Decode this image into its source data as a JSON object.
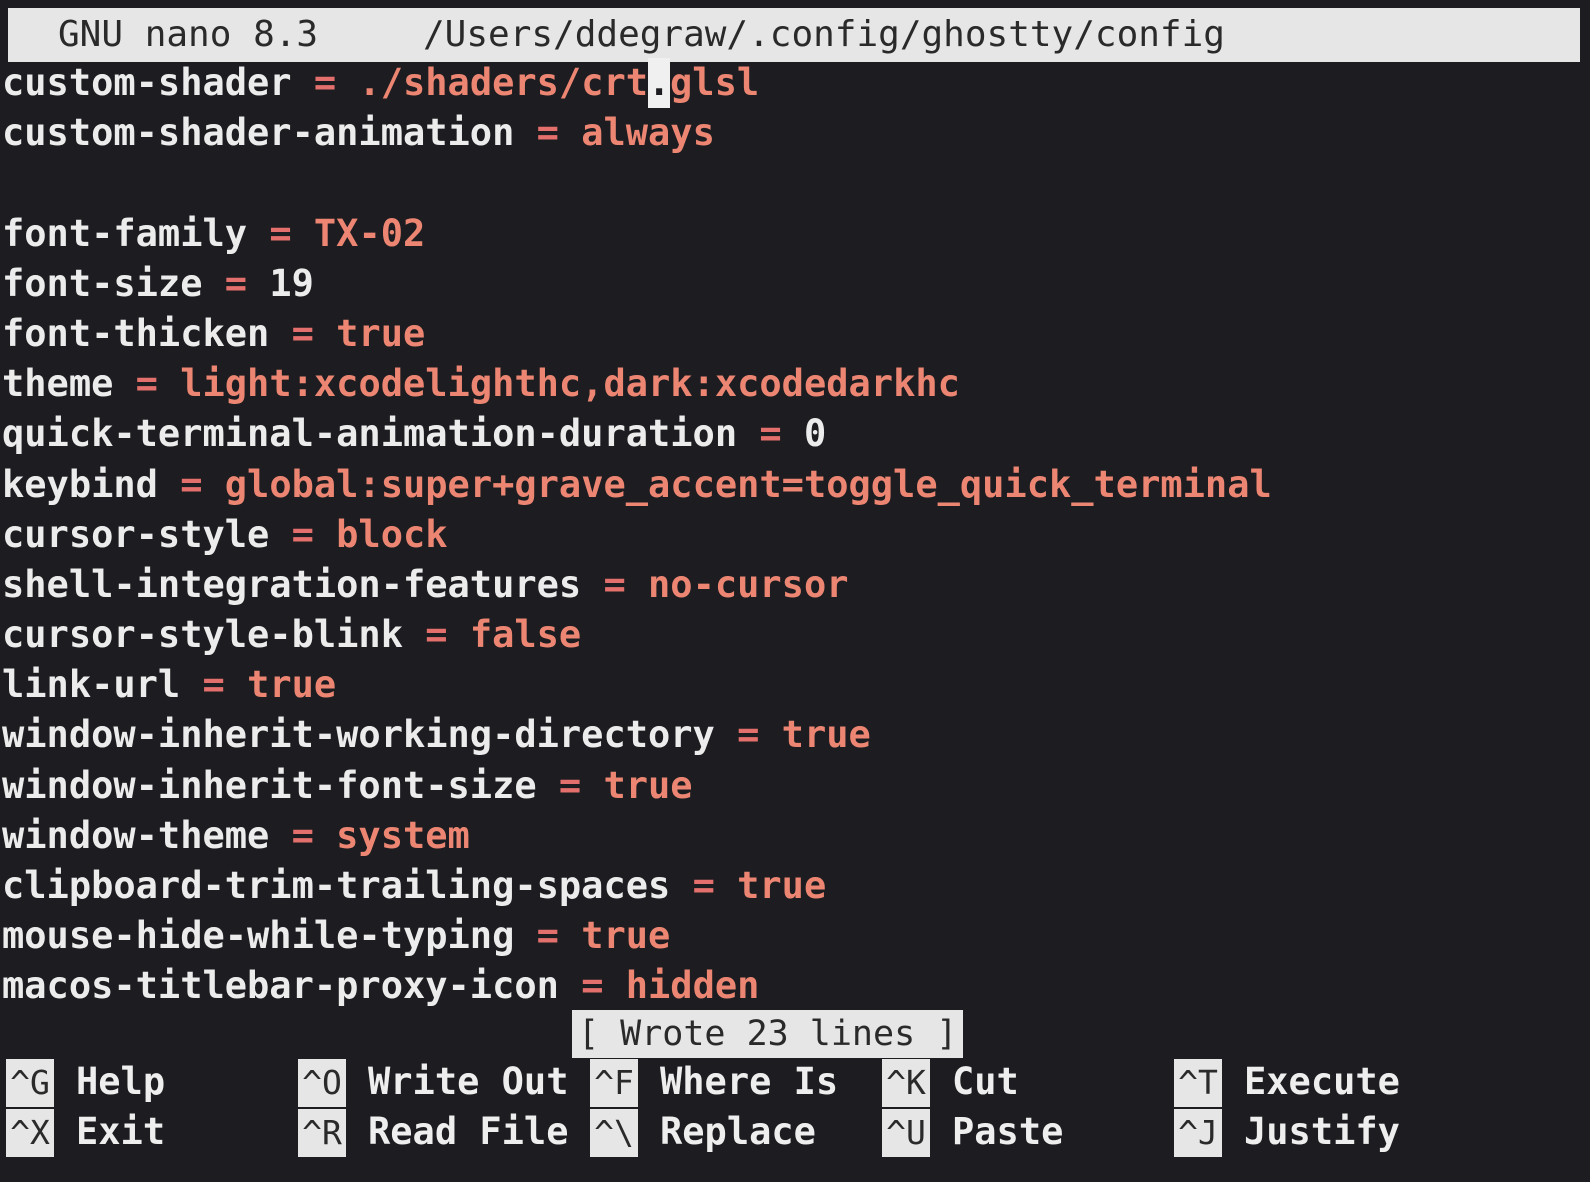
{
  "titlebar": {
    "app": "GNU nano 8.3",
    "path": "/Users/ddegraw/.config/ghostty/config"
  },
  "lines": [
    {
      "key": "custom-shader",
      "eq": "=",
      "before_cursor": "./shaders/crt",
      "cursor_char": ".",
      "after_cursor": "glsl"
    },
    {
      "key": "custom-shader-animation",
      "eq": "=",
      "value": "always"
    },
    {
      "key": "",
      "eq": "",
      "value": ""
    },
    {
      "key": "font-family",
      "eq": "=",
      "value": "TX-02"
    },
    {
      "key": "font-size",
      "eq": "=",
      "value": "19"
    },
    {
      "key": "font-thicken",
      "eq": "=",
      "value": "true"
    },
    {
      "key": "theme",
      "eq": "=",
      "value": "light:xcodelighthc,dark:xcodedarkhc"
    },
    {
      "key": "quick-terminal-animation-duration",
      "eq": "=",
      "value": "0"
    },
    {
      "key": "keybind",
      "eq": "=",
      "value": "global:super+grave_accent=toggle_quick_terminal"
    },
    {
      "key": "cursor-style",
      "eq": "=",
      "value": "block"
    },
    {
      "key": "shell-integration-features",
      "eq": "=",
      "value": "no-cursor"
    },
    {
      "key": "cursor-style-blink",
      "eq": "=",
      "value": "false"
    },
    {
      "key": "link-url",
      "eq": "=",
      "value": "true"
    },
    {
      "key": "window-inherit-working-directory",
      "eq": "=",
      "value": "true"
    },
    {
      "key": "window-inherit-font-size",
      "eq": "=",
      "value": "true"
    },
    {
      "key": "window-theme",
      "eq": "=",
      "value": "system"
    },
    {
      "key": "clipboard-trim-trailing-spaces",
      "eq": "=",
      "value": "true"
    },
    {
      "key": "mouse-hide-while-typing",
      "eq": "=",
      "value": "true"
    },
    {
      "key": "macos-titlebar-proxy-icon",
      "eq": "=",
      "value": "hidden"
    }
  ],
  "status": "[ Wrote 23 lines ]",
  "shortcuts": [
    {
      "key": "^G",
      "label": "Help"
    },
    {
      "key": "^X",
      "label": "Exit"
    },
    {
      "key": "^O",
      "label": "Write Out"
    },
    {
      "key": "^R",
      "label": "Read File"
    },
    {
      "key": "^F",
      "label": "Where Is"
    },
    {
      "key": "^\\",
      "label": "Replace"
    },
    {
      "key": "^K",
      "label": "Cut"
    },
    {
      "key": "^U",
      "label": "Paste"
    },
    {
      "key": "^T",
      "label": "Execute"
    },
    {
      "key": "^J",
      "label": "Justify"
    }
  ],
  "colors": {
    "background": "#1d1d21",
    "key_text": "#ececec",
    "value_text": "#ec8672",
    "bar_background": "#e6e6e6"
  }
}
